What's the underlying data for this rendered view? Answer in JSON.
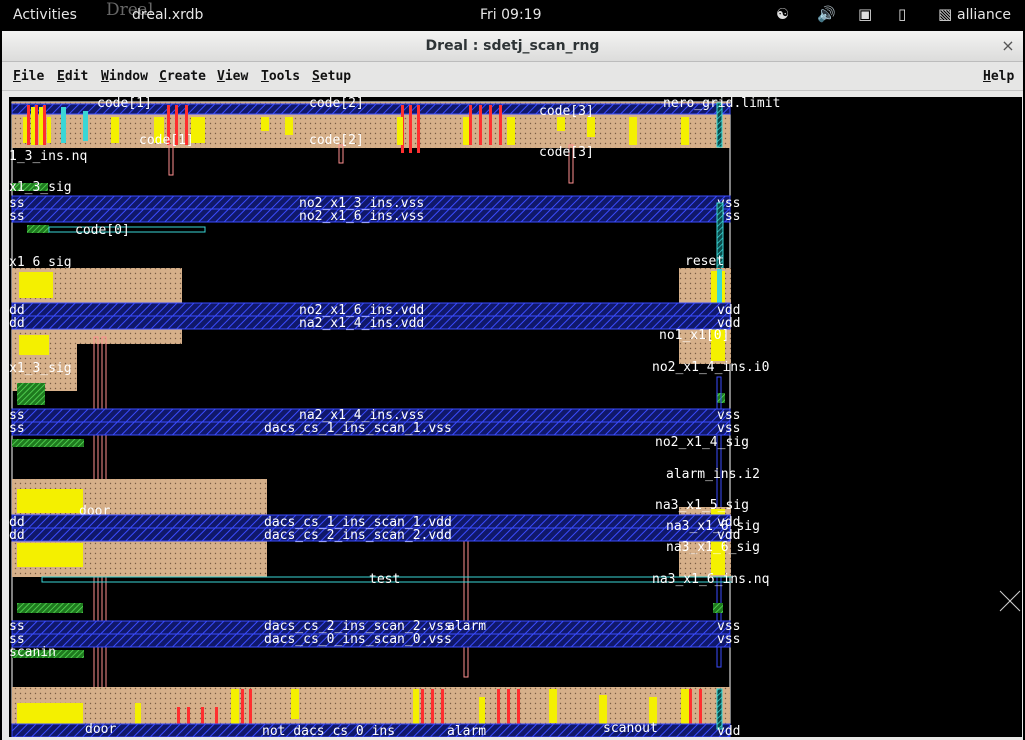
{
  "topbar": {
    "activities": "Activities",
    "app_icon_text": "Dreal",
    "app_name": "dreal.xrdb",
    "clock": "Fri 09:19",
    "user": "alliance",
    "icons": [
      "accessibility-icon",
      "volume-icon",
      "network-icon",
      "battery-icon",
      "user-icon"
    ]
  },
  "window": {
    "title": "Dreal : sdetj_scan_rng",
    "close_label": "×"
  },
  "menu": {
    "file": "File",
    "edit": "Edit",
    "window": "Window",
    "create": "Create",
    "view": "View",
    "tools": "Tools",
    "setup": "Setup",
    "help": "Help"
  },
  "colors": {
    "abutment_box": "#d6b08a",
    "metal1": "#2c3cff",
    "metal2": "#3ad6d6",
    "poly": "#ff2f2f",
    "via": "#f4f000",
    "ndiff": "#3cc83c",
    "background": "#000000"
  },
  "layout": {
    "rails": [
      {
        "left": "ss",
        "label": "no2_x1_3_ins.vss",
        "right": "vss"
      },
      {
        "left": "ss",
        "label": "no2_x1_6_ins.vss",
        "right": "vss"
      },
      {
        "left": "dd",
        "label": "no2_x1_6_ins.vdd",
        "right": "vdd"
      },
      {
        "left": "dd",
        "label": "na2_x1_4_ins.vdd",
        "right": "vdd"
      },
      {
        "left": "ss",
        "label": "na2_x1_4_ins.vss",
        "right": "vss"
      },
      {
        "left": "ss",
        "label": "dacs_cs_1_ins_scan_1.vss",
        "right": "vss"
      },
      {
        "left": "dd",
        "label": "dacs_cs_1_ins_scan_1.vdd",
        "right": "vdd"
      },
      {
        "left": "dd",
        "label": "dacs_cs_2_ins_scan_2.vdd",
        "right": "vdd"
      },
      {
        "left": "ss",
        "label": "dacs_cs_2_ins_scan_2.vss",
        "right": "vss"
      },
      {
        "left": "ss",
        "label": "dacs_cs_0_ins_scan_0.vss",
        "right": "vss"
      }
    ],
    "labels": {
      "code1": "code[1]",
      "code2": "code[2]",
      "code3": "code[3]",
      "code0": "code[0]",
      "nero_grid_limit": "nero_grid.limit",
      "ins_nq": "1_3_ins.nq",
      "x1_3_sig": "x1_3_sig",
      "x1_6_sig": "x1_6_sig",
      "sig_mid": "x1_3_sig",
      "reset": "reset",
      "no1_0": "no1_x1[0]",
      "no2_i0": "no2_x1_4_ins.i0",
      "no2_sig": "no2_x1_4_sig",
      "alarm_i2": "alarm_ins.i2",
      "na3_sig": "na3_x1_5_sig",
      "na3_sig2": "na3_x1_6_sig",
      "na3_sig3": "na3_x1_6_sig",
      "na3_nq": "na3_x1_6_ins.nq",
      "door": "door",
      "test": "test",
      "alarm": "alarm",
      "scanout": "scanout",
      "scanin": "scanin",
      "bottom": "not_dacs_cs_0_ins"
    }
  }
}
